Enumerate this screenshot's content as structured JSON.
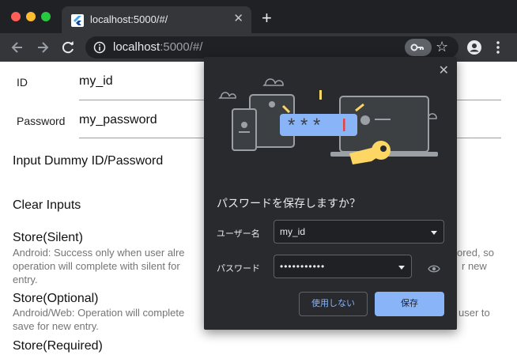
{
  "browser": {
    "tab_title": "localhost:5000/#/",
    "tab_close": "✕",
    "new_tab": "+",
    "url_host": "localhost",
    "url_rest": ":5000/#/",
    "star": "☆"
  },
  "page": {
    "id_label": "ID",
    "id_value": "my_id",
    "password_label": "Password",
    "password_value": "my_password",
    "dummy_button": "Input Dummy ID/Password",
    "clear_button": "Clear Inputs",
    "silent_title": "Store(Silent)",
    "silent_desc_1": "Android: Success only when user alre",
    "silent_desc_1_right": "ored, so",
    "silent_desc_2": "operation will complete with silent for",
    "silent_desc_2_right": "r new",
    "silent_desc_3": "entry.",
    "optional_title": "Store(Optional)",
    "optional_desc_1": "Android/Web: Operation will complete",
    "optional_desc_1_right": "user to",
    "optional_desc_2": "save for new entry.",
    "required_title": "Store(Required)"
  },
  "dialog": {
    "close": "✕",
    "title": "パスワードを保存しますか？",
    "username_label": "ユーザー名",
    "username_value": "my_id",
    "password_label": "パスワード",
    "password_value": "•••••••••••",
    "illustration_mask": "* * *",
    "cancel_label": "使用しない",
    "save_label": "保存"
  },
  "colors": {
    "accent": "#8ab4f8",
    "dialog_bg": "#292a2d",
    "key_yellow": "#fdd663"
  }
}
